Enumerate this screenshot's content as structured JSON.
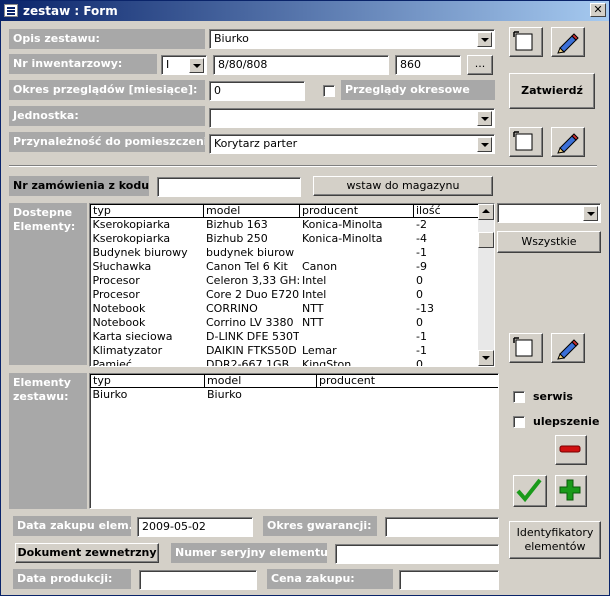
{
  "window": {
    "title": "zestaw : Form",
    "close_glyph": "✕"
  },
  "opis": {
    "label": "Opis zestawu:",
    "value": "Biurko"
  },
  "inw": {
    "label": "Nr inwentarzowy:",
    "prefix": "I",
    "value": "8/80/808",
    "extra": "860",
    "browse": "..."
  },
  "okres": {
    "label": "Okres przeglądów [miesiące]:",
    "value": "0",
    "chk_label": "Przeglądy okresowe"
  },
  "jednostka": {
    "label": "Jednostka:",
    "value": ""
  },
  "przyn": {
    "label": "Przynależność do pomieszczenia:",
    "value": "Korytarz parter"
  },
  "zatwierdz": "Zatwierdź",
  "zamowienie": {
    "label": "Nr zamówienia z kodu:",
    "value": "",
    "button": "wstaw do magazynu"
  },
  "dostepne": {
    "label": "Dostepne Elementy:",
    "columns": [
      "typ",
      "model",
      "producent",
      "ilość"
    ],
    "rows": [
      [
        "Kserokopiarka",
        "Bizhub 163",
        "Konica-Minolta",
        "-2"
      ],
      [
        "Kserokopiarka",
        "Bizhub 250",
        "Konica-Minolta",
        "-4"
      ],
      [
        "Budynek biurowy",
        "budynek biurow",
        "",
        "-1"
      ],
      [
        "Słuchawka",
        "Canon Tel 6 Kit",
        "Canon",
        "-9"
      ],
      [
        "Procesor",
        "Celeron 3,33 GH:",
        "Intel",
        "0"
      ],
      [
        "Procesor",
        "Core 2 Duo E720",
        "Intel",
        "0"
      ],
      [
        "Notebook",
        "CORRINO",
        "NTT",
        "-13"
      ],
      [
        "Notebook",
        "Corrino LV 3380",
        "NTT",
        "0"
      ],
      [
        "Karta sieciowa",
        "D-LINK DFE 530T",
        "",
        "-1"
      ],
      [
        "Klimatyzator",
        "DAIKIN FTKS50D",
        "Lemar",
        "-1"
      ],
      [
        "Pamięć",
        "DDR2-667 1GB",
        "KingSton",
        "0"
      ]
    ],
    "filter_value": "",
    "all_button": "Wszystkie"
  },
  "elementy": {
    "label": "Elementy zestawu:",
    "columns": [
      "typ",
      "model",
      "producent"
    ],
    "rows": [
      [
        "Biurko",
        "Biurko",
        ""
      ]
    ]
  },
  "serwis": "serwis",
  "ulepszenie": "ulepszenie",
  "data_zakupu": {
    "label": "Data zakupu elem.:",
    "value": "2009-05-02"
  },
  "okres_gw": {
    "label": "Okres gwarancji:",
    "value": ""
  },
  "dokument": "Dokument zewnetrzny",
  "numer_ser": {
    "label": "Numer seryjny elementu:",
    "value": ""
  },
  "data_prod": {
    "label": "Data produkcji:",
    "value": ""
  },
  "cena": {
    "label": "Cena zakupu:",
    "value": ""
  },
  "identyfikatory": "Identyfikatory elementów",
  "colors": {
    "title_start": "#0a246a",
    "title_end": "#a6caf0",
    "label_bg": "#a8a8a8",
    "face": "#d4d0c8",
    "check_green": "#1a9a1a",
    "minus_red": "#d01010"
  }
}
